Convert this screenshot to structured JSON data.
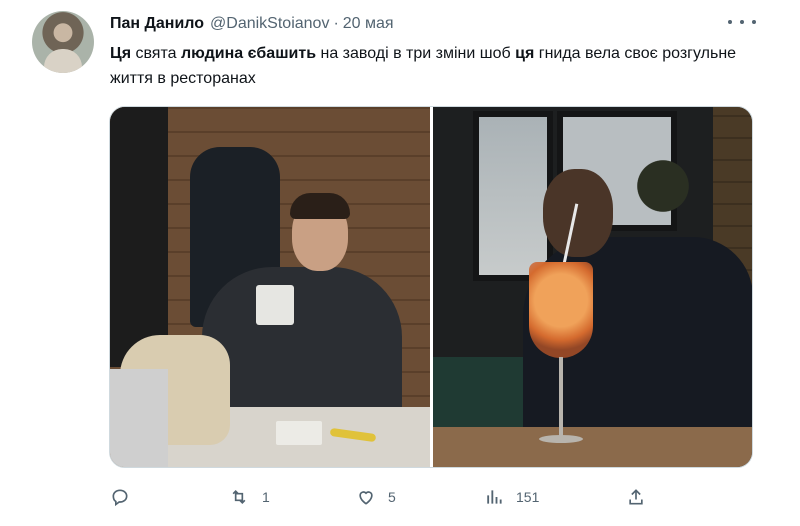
{
  "tweet": {
    "author_name": "Пан Данило",
    "handle": "@DanikStoianov",
    "separator": "·",
    "date": "20 мая",
    "text_parts": {
      "p1": "Ця",
      "p2": " свята ",
      "p3": "людина єбашить",
      "p4": " на заводі в три зміни шоб ",
      "p5": "ця",
      "p6": " гнида вела своє розгульне життя в ресторанах"
    }
  },
  "actions": {
    "reply_icon": "reply-icon",
    "retweet_count": "1",
    "like_count": "5",
    "views_count": "151",
    "share_icon": "share-icon"
  },
  "colors": {
    "text": "#0f1419",
    "secondary": "#536471",
    "border": "#cfd9de"
  }
}
